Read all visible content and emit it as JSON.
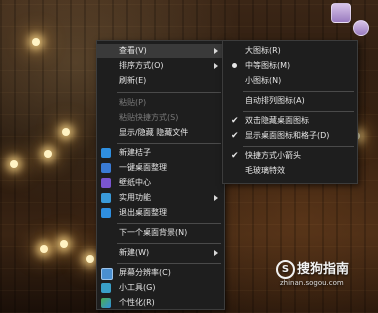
{
  "context_menu": {
    "items": [
      {
        "label": "查看(V)",
        "state": "highlighted",
        "submenu": true
      },
      {
        "label": "排序方式(O)",
        "state": "normal",
        "submenu": true
      },
      {
        "label": "刷新(E)",
        "state": "normal"
      },
      {
        "label": "粘贴(P)",
        "state": "disabled"
      },
      {
        "label": "粘贴快捷方式(S)",
        "state": "disabled"
      },
      {
        "label": "显示/隐藏 隐藏文件",
        "state": "normal"
      },
      {
        "label": "新建桔子",
        "state": "normal",
        "icon": "plus-icon"
      },
      {
        "label": "一键桌面整理",
        "state": "normal",
        "icon": "grid-icon"
      },
      {
        "label": "壁纸中心",
        "state": "normal",
        "icon": "cube-icon"
      },
      {
        "label": "实用功能",
        "state": "normal",
        "icon": "tiles-icon",
        "submenu": true
      },
      {
        "label": "退出桌面整理",
        "state": "normal",
        "icon": "exit-icon"
      },
      {
        "label": "下一个桌面背景(N)",
        "state": "normal"
      },
      {
        "label": "新建(W)",
        "state": "normal",
        "submenu": true
      },
      {
        "label": "屏幕分辨率(C)",
        "state": "normal",
        "icon": "monitor-icon"
      },
      {
        "label": "小工具(G)",
        "state": "normal",
        "icon": "gadgets-icon"
      },
      {
        "label": "个性化(R)",
        "state": "normal",
        "icon": "personalize-icon"
      }
    ]
  },
  "view_submenu": {
    "items": [
      {
        "label": "大图标(R)",
        "mark": "none"
      },
      {
        "label": "中等图标(M)",
        "mark": "radio"
      },
      {
        "label": "小图标(N)",
        "mark": "none"
      },
      {
        "label": "自动排列图标(A)",
        "mark": "none"
      },
      {
        "label": "双击隐藏桌面图标",
        "mark": "check"
      },
      {
        "label": "显示桌面图标和格子(D)",
        "mark": "check"
      },
      {
        "label": "快捷方式小箭头",
        "mark": "check"
      },
      {
        "label": "毛玻璃特效",
        "mark": "none"
      }
    ]
  },
  "watermark": {
    "logo_char": "S",
    "brand": "搜狗指南",
    "url": "zhinan.sogou.com"
  },
  "colors": {
    "menu_bg": "#1e1e1e",
    "menu_text": "#e6e6e6",
    "disabled_text": "#7a7a7a",
    "highlight": "#3a3a3a"
  }
}
